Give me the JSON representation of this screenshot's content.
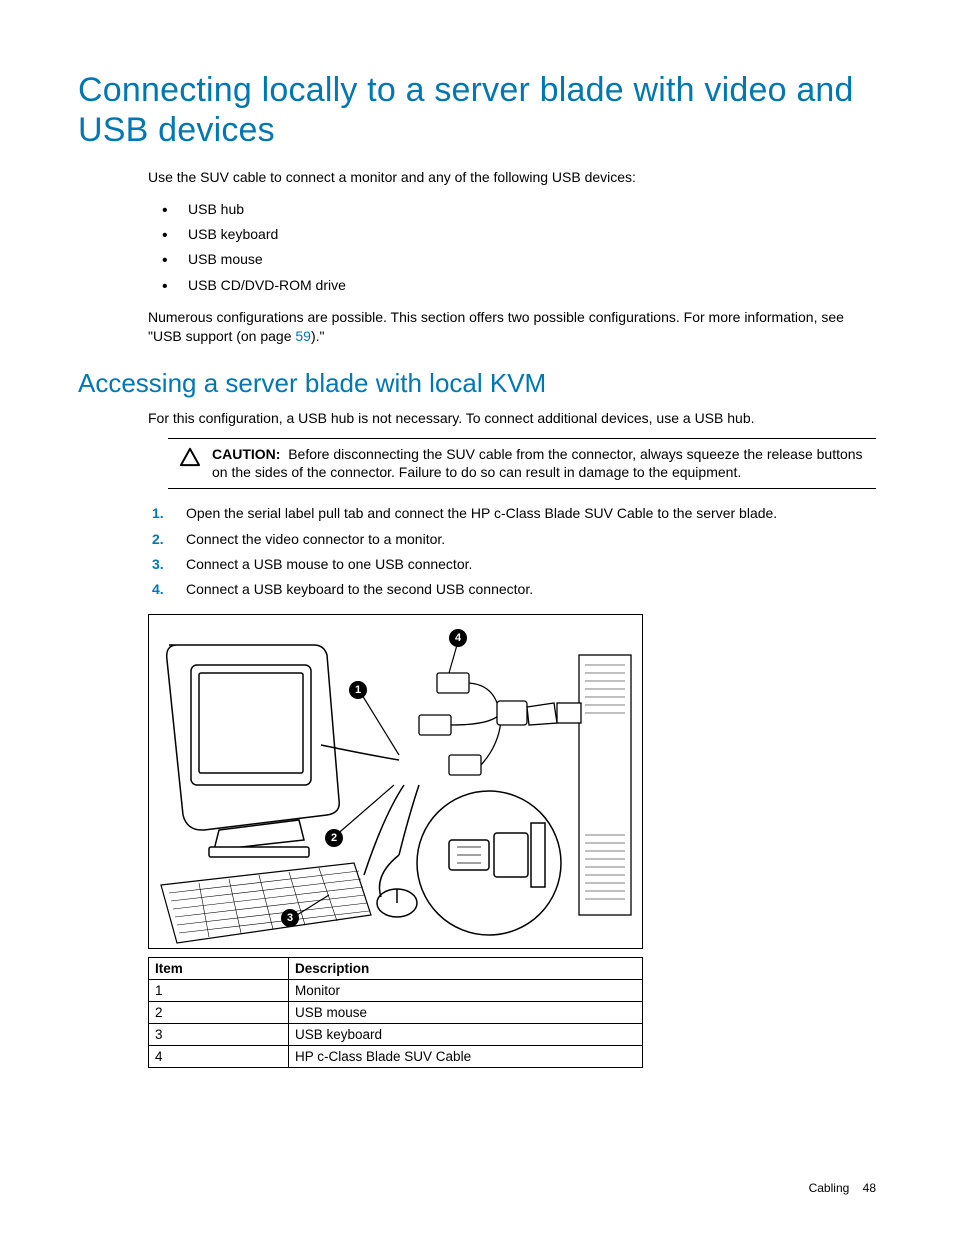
{
  "title": "Connecting locally to a server blade with video and USB devices",
  "intro": "Use the SUV cable to connect a monitor and any of the following USB devices:",
  "bullets": [
    "USB hub",
    "USB keyboard",
    "USB mouse",
    "USB CD/DVD-ROM drive"
  ],
  "para2_a": "Numerous configurations are possible. This section offers two possible configurations. For more information, see \"USB support (on page ",
  "para2_link": "59",
  "para2_b": ").\"",
  "subtitle": "Accessing a server blade with local KVM",
  "sub_intro": "For this configuration, a USB hub is not necessary. To connect additional devices, use a USB hub.",
  "caution_label": "CAUTION:",
  "caution_text": "Before disconnecting the SUV cable from the connector, always squeeze the release buttons on the sides of the connector. Failure to do so can result in damage to the equipment.",
  "steps": [
    "Open the serial label pull tab and connect the HP c-Class Blade SUV Cable to the server blade.",
    "Connect the video connector to a monitor.",
    "Connect a USB mouse to one USB connector.",
    "Connect a USB keyboard to the second USB connector."
  ],
  "callouts": {
    "1": "1",
    "2": "2",
    "3": "3",
    "4": "4"
  },
  "legend": {
    "headers": {
      "item": "Item",
      "desc": "Description"
    },
    "rows": [
      {
        "item": "1",
        "desc": "Monitor"
      },
      {
        "item": "2",
        "desc": "USB mouse"
      },
      {
        "item": "3",
        "desc": "USB keyboard"
      },
      {
        "item": "4",
        "desc": "HP c-Class Blade SUV Cable"
      }
    ]
  },
  "footer": {
    "section": "Cabling",
    "page": "48"
  }
}
